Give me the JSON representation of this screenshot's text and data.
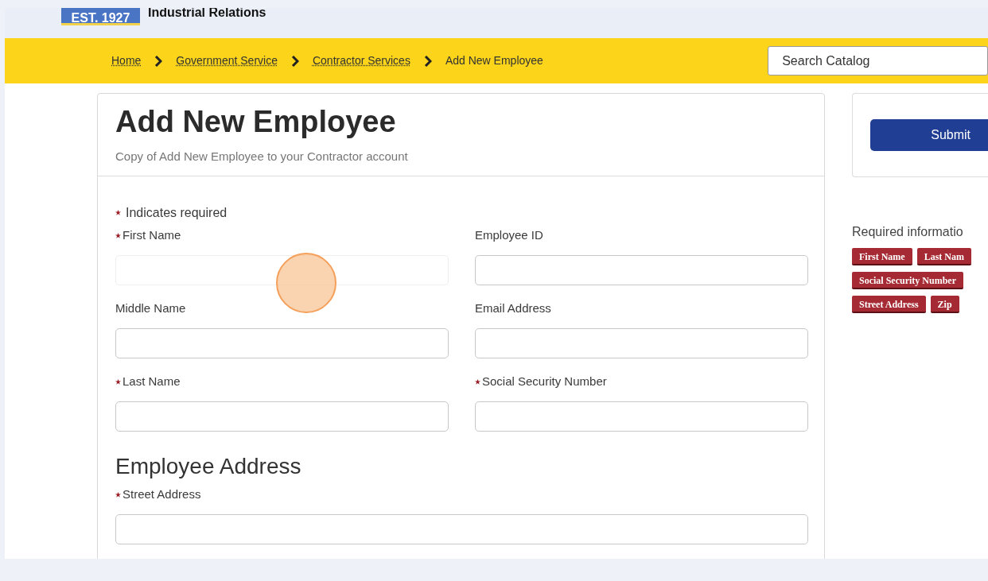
{
  "header": {
    "logo_badge": "EST. 1927",
    "agency": "Industrial Relations"
  },
  "breadcrumb": [
    {
      "label": "Home",
      "link": true
    },
    {
      "label": "Government Service",
      "link": true
    },
    {
      "label": "Contractor Services",
      "link": true
    },
    {
      "label": "Add New Employee",
      "link": false
    }
  ],
  "search": {
    "placeholder": "Search Catalog"
  },
  "form": {
    "title": "Add New Employee",
    "subtitle": "Copy of Add New Employee to your Contractor account",
    "required_note": "Indicates required",
    "fields": [
      {
        "label": "First Name",
        "required": true,
        "focused": true
      },
      {
        "label": "Employee ID",
        "required": false,
        "focused": false
      },
      {
        "label": "Middle Name",
        "required": false,
        "focused": false
      },
      {
        "label": "Email Address",
        "required": false,
        "focused": false
      },
      {
        "label": "Last Name",
        "required": true,
        "focused": false
      },
      {
        "label": "Social Security Number",
        "required": true,
        "focused": false
      }
    ],
    "section": "Employee Address",
    "address_fields": [
      {
        "label": "Street Address",
        "required": true,
        "focused": false
      }
    ]
  },
  "sidebar": {
    "submit": "Submit",
    "required_title": "Required informatio",
    "tags": [
      [
        "First Name",
        "Last Nam"
      ],
      [
        "Social Security Number"
      ],
      [
        "Street Address",
        "Zip"
      ]
    ]
  }
}
